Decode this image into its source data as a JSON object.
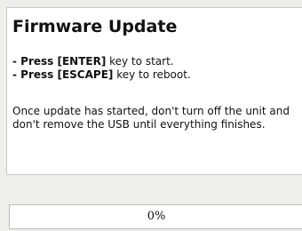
{
  "dialog": {
    "title": "Firmware Update",
    "instructions": [
      {
        "prefix": "- Press ",
        "key": "[ENTER]",
        "suffix": " key to start."
      },
      {
        "prefix": "- Press ",
        "key": "[ESCAPE]",
        "suffix": " key to reboot."
      }
    ],
    "note": "Once update has started, don't turn off the unit and don't remove the USB until everything finishes."
  },
  "progress": {
    "label": "0%",
    "fraction": 0
  }
}
